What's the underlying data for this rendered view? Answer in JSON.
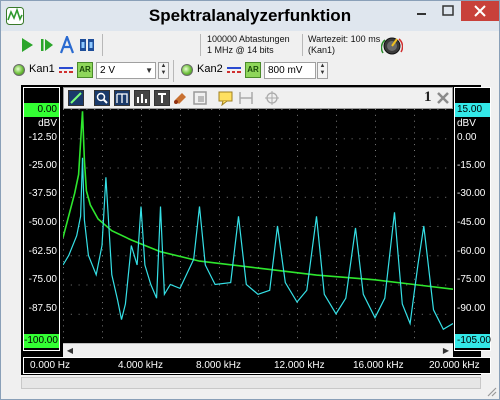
{
  "window": {
    "title": "Spektralanalyzerfunktion"
  },
  "toolbar": {
    "acquisition_info": [
      "100000 Abtastungen",
      "1 MHz @ 14 bits"
    ],
    "wait_info": [
      "Wartezeit: 100 ms",
      "(Kan1)"
    ]
  },
  "channels": [
    {
      "label": "Kan1",
      "range": "2 V",
      "ar_label": "AR"
    },
    {
      "label": "Kan2",
      "range": "800 mV",
      "ar_label": "AR"
    }
  ],
  "plot_toolbar": {
    "count": "1"
  },
  "y_axis_left": {
    "top_value": "0.00",
    "unit": "dBV",
    "ticks": [
      "-12.50",
      "-25.00",
      "-37.50",
      "-50.00",
      "-62.50",
      "-75.00",
      "-87.50"
    ],
    "bottom_value": "-100.00",
    "color": "#33ff33"
  },
  "y_axis_right": {
    "top_value": "15.00",
    "unit": "dBV",
    "ticks": [
      "0.00",
      "-15.00",
      "-30.00",
      "-45.00",
      "-60.00",
      "-75.00",
      "-90.00"
    ],
    "bottom_value": "-105.00",
    "color": "#33e8e8"
  },
  "x_axis": {
    "ticks": [
      "0.000 Hz",
      "4.000 kHz",
      "8.000 kHz",
      "12.000 kHz",
      "16.000 kHz",
      "20.000 kHz"
    ]
  },
  "chart_data": {
    "type": "line",
    "xlabel": "",
    "ylabel": "dBV",
    "xlim": [
      0,
      20000
    ],
    "series": [
      {
        "name": "Kan1",
        "color": "#2ee62e",
        "axis": "left",
        "ylim": [
          -100,
          0
        ],
        "x": [
          0,
          600,
          800,
          1000,
          1100,
          1200,
          1400,
          1800,
          2500,
          3500,
          5000,
          7000,
          10000,
          13000,
          16000,
          18000,
          20000
        ],
        "y": [
          -55,
          -36,
          -28,
          -1,
          -22,
          -35,
          -41,
          -47,
          -52,
          -56,
          -61,
          -65,
          -68,
          -71,
          -73,
          -75,
          -77
        ]
      },
      {
        "name": "Kan2",
        "color": "#35e0e6",
        "axis": "right",
        "ylim": [
          -105,
          15
        ],
        "x": [
          0,
          300,
          700,
          900,
          1000,
          1100,
          1300,
          1700,
          2000,
          2200,
          2500,
          2800,
          3000,
          3200,
          3500,
          3800,
          4000,
          4200,
          4500,
          4800,
          5000,
          5200,
          5500,
          6000,
          6700,
          7000,
          7300,
          7800,
          8600,
          9000,
          9400,
          10000,
          10600,
          11000,
          11400,
          12000,
          12500,
          13000,
          13400,
          14000,
          14500,
          15000,
          15400,
          16000,
          16500,
          17000,
          17400,
          17800,
          18200,
          18500,
          19000,
          19500,
          20000
        ],
        "y": [
          -65,
          -60,
          -50,
          -40,
          -10,
          -42,
          -60,
          -70,
          -55,
          -20,
          -70,
          -83,
          -93,
          -85,
          -55,
          -65,
          -35,
          -65,
          -75,
          -82,
          -35,
          -80,
          -75,
          -77,
          -62,
          -35,
          -65,
          -75,
          -74,
          -40,
          -75,
          -80,
          -78,
          -45,
          -74,
          -84,
          -78,
          -40,
          -80,
          -90,
          -82,
          -46,
          -80,
          -92,
          -82,
          -38,
          -85,
          -95,
          -65,
          -45,
          -88,
          -98,
          -95
        ]
      }
    ]
  }
}
